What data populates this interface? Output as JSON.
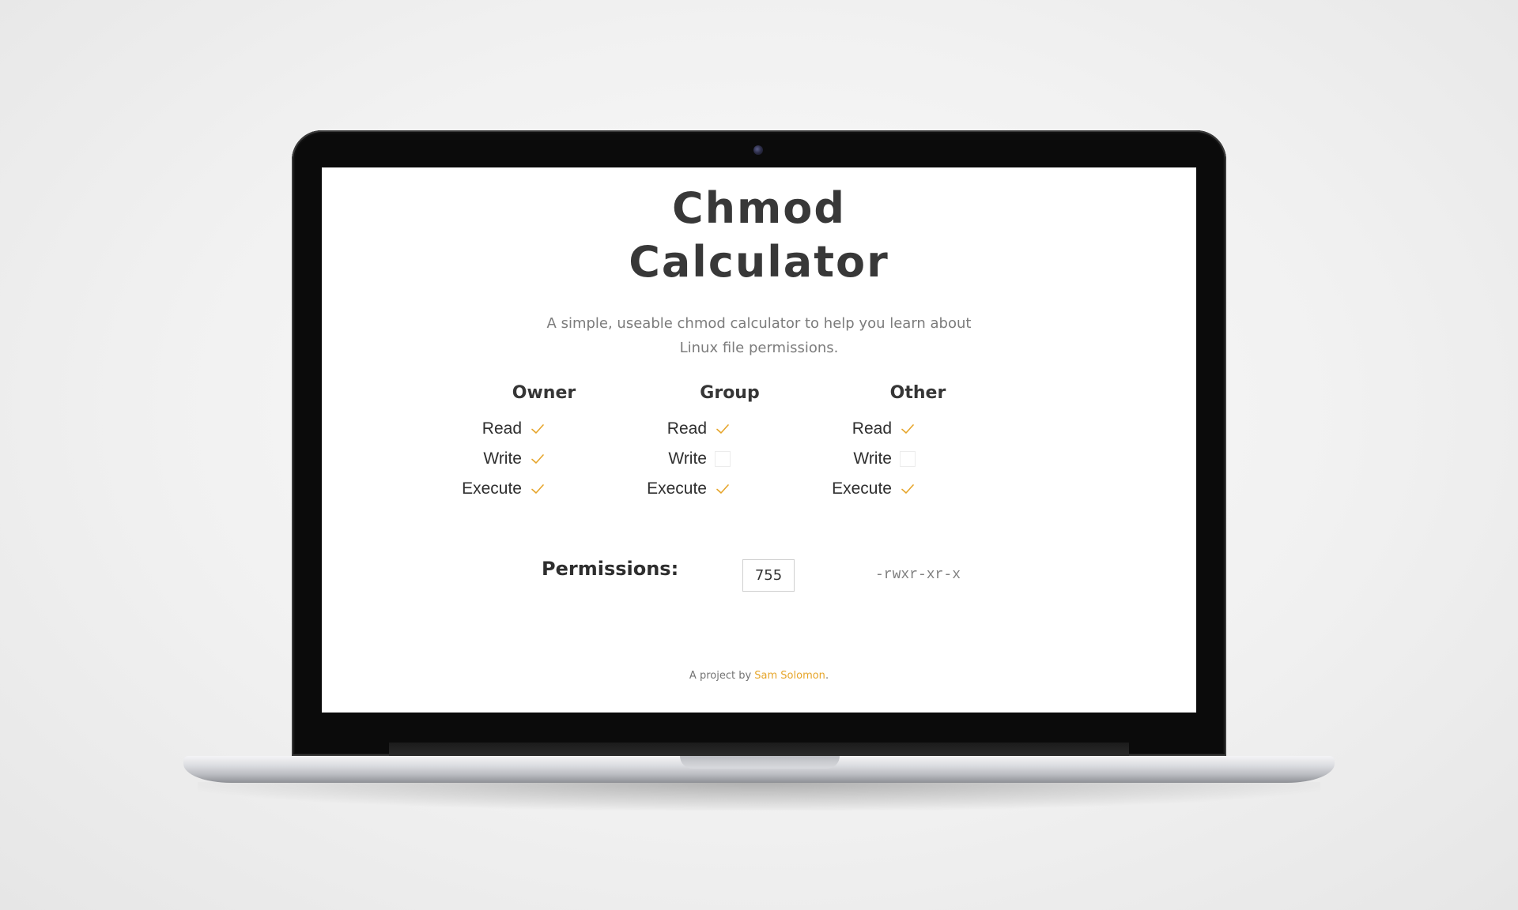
{
  "app": {
    "title_line1": "Chmod",
    "title_line2": "Calculator",
    "subtitle_line1": "A simple, useable chmod calculator to help you learn about",
    "subtitle_line2": "Linux file permissions."
  },
  "columns": [
    {
      "header": "Owner",
      "rows": [
        {
          "label": "Read",
          "checked": true
        },
        {
          "label": "Write",
          "checked": true
        },
        {
          "label": "Execute",
          "checked": true
        }
      ]
    },
    {
      "header": "Group",
      "rows": [
        {
          "label": "Read",
          "checked": true
        },
        {
          "label": "Write",
          "checked": false
        },
        {
          "label": "Execute",
          "checked": true
        }
      ]
    },
    {
      "header": "Other",
      "rows": [
        {
          "label": "Read",
          "checked": true
        },
        {
          "label": "Write",
          "checked": false
        },
        {
          "label": "Execute",
          "checked": true
        }
      ]
    }
  ],
  "permissions": {
    "label": "Permissions:",
    "octal": "755",
    "symbolic": "-rwxr-xr-x"
  },
  "footer": {
    "prefix": "A project by ",
    "author": "Sam Solomon",
    "suffix": "."
  },
  "colors": {
    "accent": "#e6a52a",
    "text_dark": "#363636",
    "text_muted": "#7c7c7c"
  }
}
